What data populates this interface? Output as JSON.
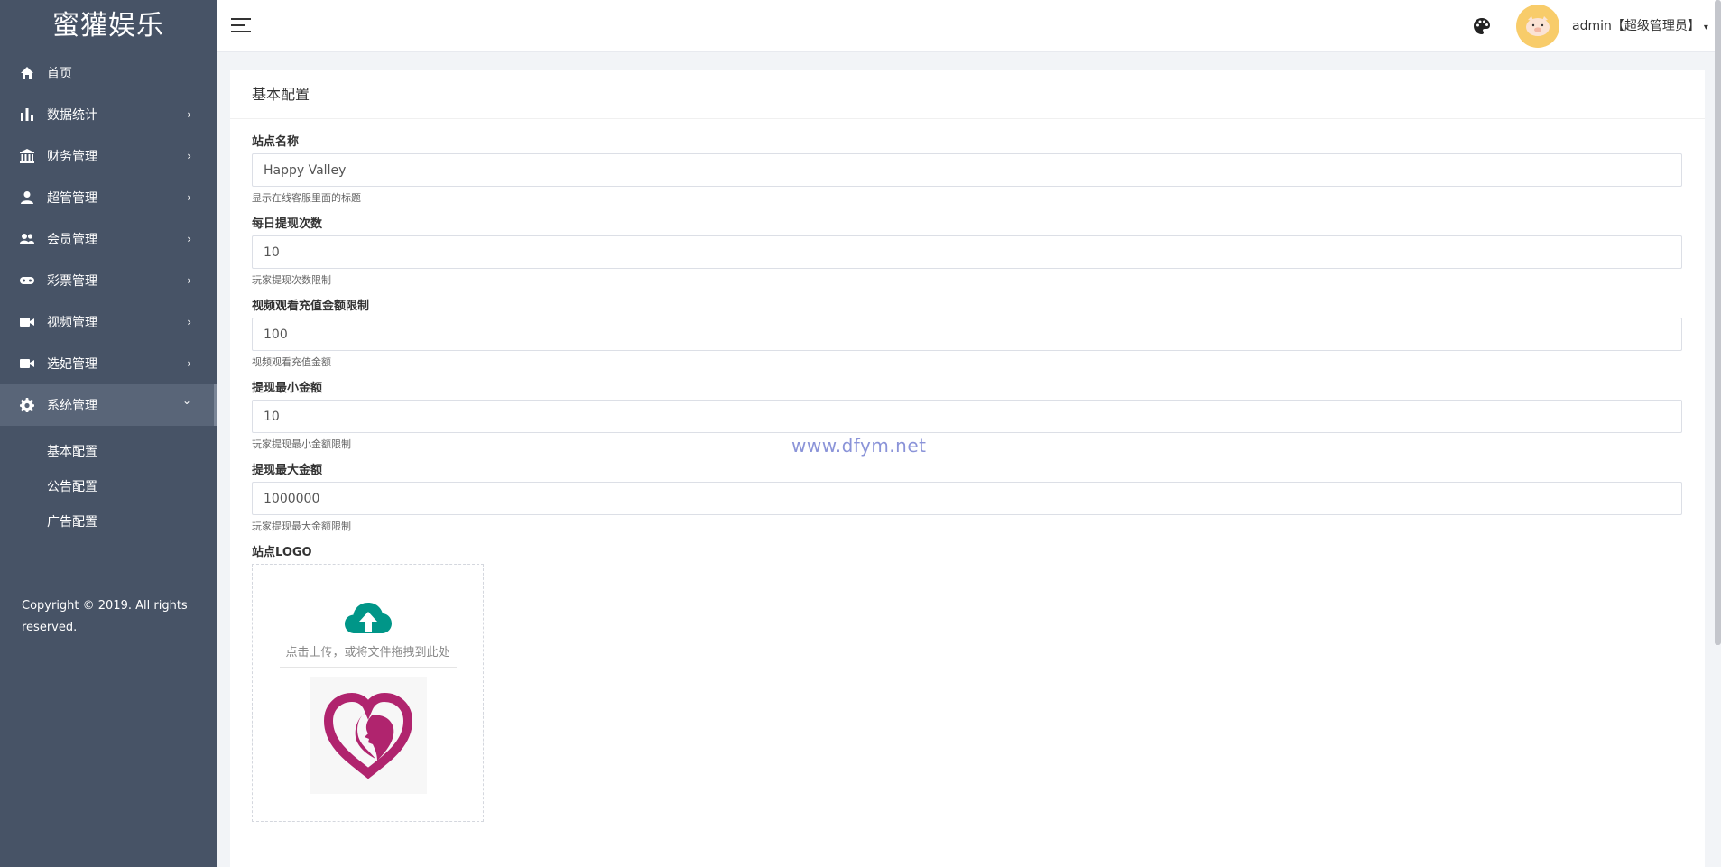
{
  "brand": {
    "logo_text": "蜜獾娱乐"
  },
  "sidebar": {
    "items": [
      {
        "label": "首页",
        "icon": "home-icon",
        "has_children": false
      },
      {
        "label": "数据统计",
        "icon": "bar-chart-icon",
        "has_children": true
      },
      {
        "label": "财务管理",
        "icon": "bank-icon",
        "has_children": true
      },
      {
        "label": "超管管理",
        "icon": "user-icon",
        "has_children": true
      },
      {
        "label": "会员管理",
        "icon": "users-icon",
        "has_children": true
      },
      {
        "label": "彩票管理",
        "icon": "gamepad-icon",
        "has_children": true
      },
      {
        "label": "视频管理",
        "icon": "video-icon",
        "has_children": true
      },
      {
        "label": "选妃管理",
        "icon": "video-icon",
        "has_children": true
      },
      {
        "label": "系统管理",
        "icon": "gear-icon",
        "has_children": true,
        "expanded": true
      }
    ],
    "arrow_collapsed": "›",
    "arrow_expanded": "⌄",
    "sub_items": [
      {
        "label": "基本配置"
      },
      {
        "label": "公告配置"
      },
      {
        "label": "广告配置"
      }
    ],
    "copyright": "Copyright © 2019. All rights reserved."
  },
  "header": {
    "user_label": "admin【超级管理员】",
    "caret": "▾"
  },
  "card": {
    "title": "基本配置",
    "fields": [
      {
        "label": "站点名称",
        "value": "Happy Valley",
        "help": "显示在线客服里面的标题"
      },
      {
        "label": "每日提现次数",
        "value": "10",
        "help": "玩家提现次数限制"
      },
      {
        "label": "视频观看充值金额限制",
        "value": "100",
        "help": "视频观看充值金额"
      },
      {
        "label": "提现最小金额",
        "value": "10",
        "help": "玩家提现最小金额限制"
      },
      {
        "label": "提现最大金额",
        "value": "1000000",
        "help": "玩家提现最大金额限制"
      }
    ],
    "logo_field": {
      "label": "站点LOGO",
      "upload_text": "点击上传，或将文件拖拽到此处"
    }
  },
  "watermark": "www.dfym.net",
  "colors": {
    "sidebar_bg": "#475366",
    "sidebar_active": "#596578",
    "upload_icon": "#009688",
    "logo_heart": "#b0246e",
    "avatar_bg": "#f8cc6a"
  }
}
